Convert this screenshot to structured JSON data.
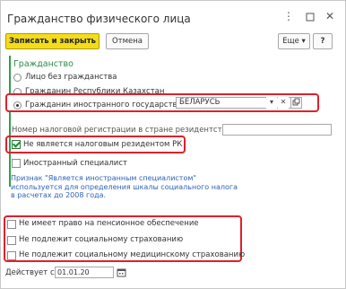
{
  "window": {
    "title": "Гражданство физического лица",
    "menu_icon": "more-vertical-icon",
    "maximize_icon": "restore-icon",
    "close_icon": "close-icon"
  },
  "toolbar": {
    "save_close_label": "Записать и закрыть",
    "cancel_label": "Отмена",
    "more_label": "Еще ▾",
    "help_label": "?"
  },
  "citizenship": {
    "section_title": "Гражданство",
    "options": [
      {
        "label": "Лицо без гражданства",
        "checked": false
      },
      {
        "label": "Гражданин Республики Казахстан",
        "checked": false
      },
      {
        "label": "Гражданин иностранного государства",
        "checked": true
      }
    ],
    "country_value": "БЕЛАРУСЬ"
  },
  "tax": {
    "reg_number_label": "Номер налоговой регистрации в стране резидентства:",
    "reg_number_value": "",
    "non_resident_label": "Не является налоговым резидентом РК",
    "non_resident_checked": true,
    "foreign_specialist_label": "Иностранный специалист",
    "foreign_specialist_checked": false,
    "note": "Признак \"Является иностранным специалистом\" используется для определения шкалы социального налога в расчетах до 2008 года."
  },
  "insurance": {
    "items": [
      {
        "label": "Не имеет право на пенсионное обеспечение",
        "checked": false
      },
      {
        "label": "Не подлежит социальному страхованию",
        "checked": false
      },
      {
        "label": "Не подлежит социальному медицинскому страхованию",
        "checked": false
      }
    ]
  },
  "valid_from": {
    "label": "Действует с:",
    "value": "01.01.20",
    "calendar_icon": "calendar-icon"
  },
  "colors": {
    "primary_button": "#f3dc1c",
    "highlight": "#e0202c",
    "section_accent": "#2c8b46",
    "note_text": "#2f63b6"
  }
}
